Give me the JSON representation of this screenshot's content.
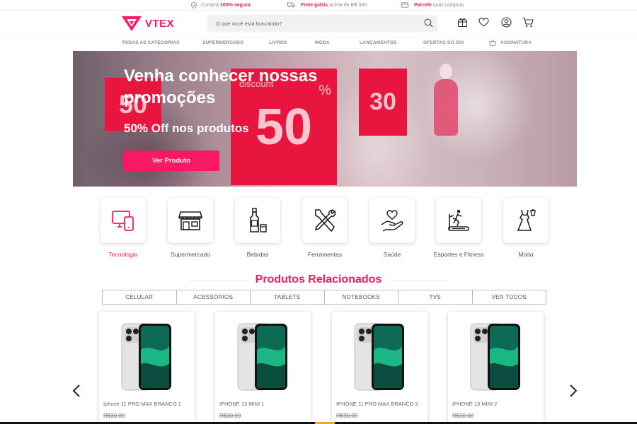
{
  "topbar": {
    "item1_pre": "Compra",
    "item1_bold": "100% segura",
    "item1_post": "",
    "item2_pre": "",
    "item2_bold": "Frete grátis",
    "item2_post": "acima de R$ 300",
    "item3_pre": "",
    "item3_bold": "Parcele",
    "item3_post": "suas compras"
  },
  "brand": {
    "logo_text": "VTEX",
    "color": "#f71963"
  },
  "search": {
    "placeholder": "O que você está buscando?"
  },
  "header_icons": [
    "gift-box-icon",
    "heart-icon",
    "user-icon",
    "cart-icon"
  ],
  "nav": {
    "items": [
      "TODAS AS CATEGORIAS",
      "SUPERMERCADO",
      "LIVROS",
      "MODA",
      "LANÇAMENTOS",
      "OFERTAS DO DIA",
      "ASSINATURA"
    ]
  },
  "banner": {
    "title": "Venha conhecer nossas promoções",
    "subtitle": "50% Off nos produtos",
    "button": "Ver Produto",
    "sign1": "50",
    "sign2": "50",
    "sign2_discount": "discount",
    "sign2_pct": "%",
    "sign3": "30"
  },
  "categories": [
    {
      "label": "Tecnologia",
      "icon": "devices-icon",
      "active": true
    },
    {
      "label": "Supermercado",
      "icon": "store-icon",
      "active": false
    },
    {
      "label": "Bebidas",
      "icon": "bottle-icon",
      "active": false
    },
    {
      "label": "Ferramentas",
      "icon": "tools-icon",
      "active": false
    },
    {
      "label": "Saúde",
      "icon": "heart-hand-icon",
      "active": false
    },
    {
      "label": "Esportes e Fitness",
      "icon": "treadmill-icon",
      "active": false
    },
    {
      "label": "Moda",
      "icon": "dress-icon",
      "active": false
    }
  ],
  "related": {
    "title": "Produtos Relacionados",
    "tabs": [
      "CELULAR",
      "ACESSÓRIOS",
      "TABLETS",
      "NOTEBOOKS",
      "TVS",
      "VER TODOS"
    ],
    "products": [
      {
        "name": "Iphone 11 PRO MAX BRANCO 1",
        "price": "R$30,00"
      },
      {
        "name": "IPHONE 13 MINI 1",
        "price": "R$30,00"
      },
      {
        "name": "IPHONE 11 PRO MAX BRANCO 2",
        "price": "R$30,00"
      },
      {
        "name": "IPHONE 13 MINI 2",
        "price": "R$30,00"
      }
    ]
  }
}
